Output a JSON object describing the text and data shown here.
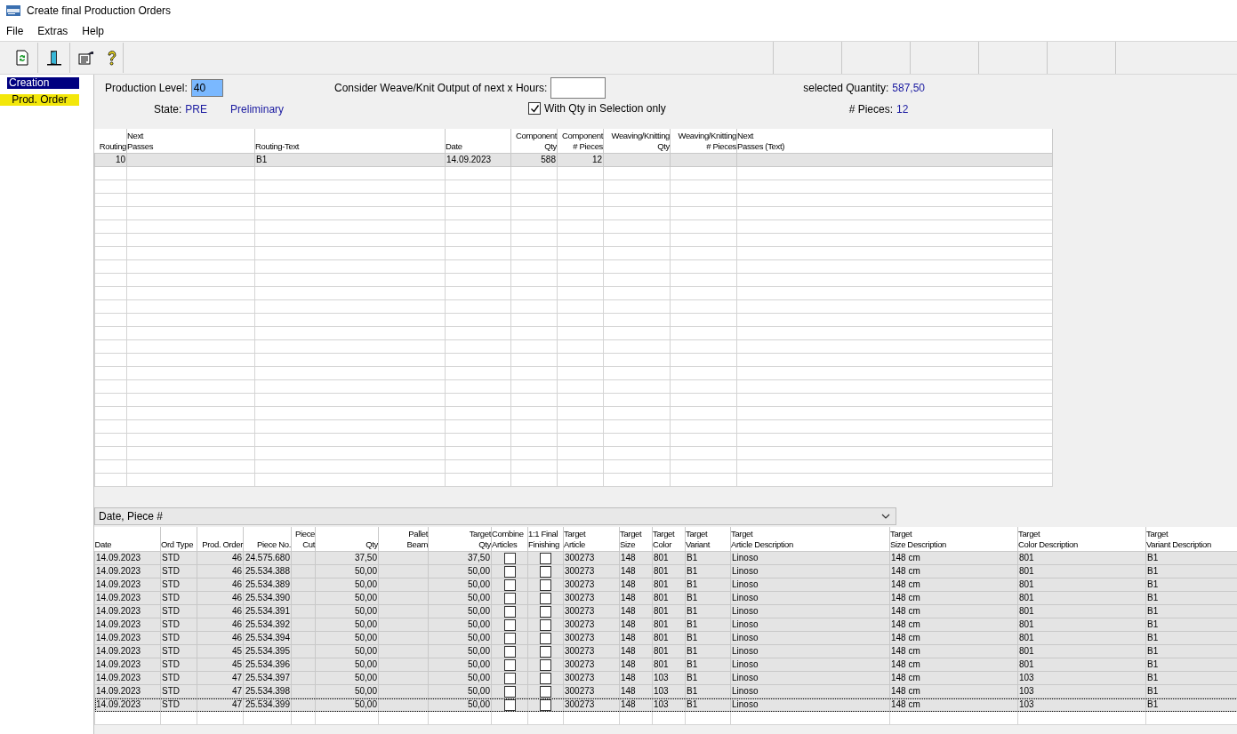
{
  "window": {
    "title": "Create final Production Orders"
  },
  "menu": [
    "File",
    "Extras",
    "Help"
  ],
  "nav": [
    {
      "kind": "group",
      "label": "Creation",
      "selected": false
    },
    {
      "kind": "item",
      "label": "Prod. Order",
      "selected": true
    }
  ],
  "form": {
    "production_level_label": "Production Level:",
    "production_level": "40",
    "state_label": "State:",
    "state_code": "PRE",
    "state_text": "Preliminary",
    "hours_label": "Consider Weave/Knit Output of next x Hours:",
    "qty_only_label": "With Qty in Selection only",
    "qty_only_checked": true,
    "selected_qty_label": "selected Quantity:",
    "selected_qty": "587,50",
    "pieces_label": "# Pieces:",
    "pieces": "12"
  },
  "routing_table": {
    "columns": [
      "Routing",
      "Next\nPasses",
      "Routing-Text",
      "Date",
      "Component\nQty",
      "Component\n# Pieces",
      "Weaving/Knitting\nQty",
      "Weaving/Knitting\n# Pieces",
      "Next\nPasses (Text)"
    ],
    "rows": [
      [
        "10",
        "",
        "B1",
        "14.09.2023",
        "588",
        "12",
        "",
        "",
        ""
      ]
    ]
  },
  "sort_dropdown": {
    "value": "Date, Piece #"
  },
  "orders_table": {
    "columns": [
      "Date",
      "Ord Type",
      "Prod. Order",
      "Piece No.",
      "Piece\nCut",
      "Qty",
      "Pallet\nBeam",
      "Target\nQty",
      "Combine\nArticles",
      "1:1 Final\nFinishing",
      "Target\nArticle",
      "Target\nSize",
      "Target\nColor",
      "Target\nVariant",
      "Target\nArticle Description",
      "Target\nSize Description",
      "Target\nColor Description",
      "Target\nVariant Description"
    ],
    "rows": [
      {
        "date": "14.09.2023",
        "ord_type": "STD",
        "prod_order": "46",
        "piece_no": "24.575.680",
        "qty": "37,50",
        "target_qty": "37,50",
        "combine": false,
        "finishing": false,
        "article": "300273",
        "size": "148",
        "color_code": "801",
        "variant": "B1",
        "article_desc": "Linoso",
        "size_desc": "148 cm",
        "color_desc": "801",
        "variant_desc": "B1",
        "selected": false
      },
      {
        "date": "14.09.2023",
        "ord_type": "STD",
        "prod_order": "46",
        "piece_no": "25.534.388",
        "qty": "50,00",
        "target_qty": "50,00",
        "combine": false,
        "finishing": false,
        "article": "300273",
        "size": "148",
        "color_code": "801",
        "variant": "B1",
        "article_desc": "Linoso",
        "size_desc": "148 cm",
        "color_desc": "801",
        "variant_desc": "B1",
        "selected": false
      },
      {
        "date": "14.09.2023",
        "ord_type": "STD",
        "prod_order": "46",
        "piece_no": "25.534.389",
        "qty": "50,00",
        "target_qty": "50,00",
        "combine": false,
        "finishing": false,
        "article": "300273",
        "size": "148",
        "color_code": "801",
        "variant": "B1",
        "article_desc": "Linoso",
        "size_desc": "148 cm",
        "color_desc": "801",
        "variant_desc": "B1",
        "selected": false
      },
      {
        "date": "14.09.2023",
        "ord_type": "STD",
        "prod_order": "46",
        "piece_no": "25.534.390",
        "qty": "50,00",
        "target_qty": "50,00",
        "combine": false,
        "finishing": false,
        "article": "300273",
        "size": "148",
        "color_code": "801",
        "variant": "B1",
        "article_desc": "Linoso",
        "size_desc": "148 cm",
        "color_desc": "801",
        "variant_desc": "B1",
        "selected": false
      },
      {
        "date": "14.09.2023",
        "ord_type": "STD",
        "prod_order": "46",
        "piece_no": "25.534.391",
        "qty": "50,00",
        "target_qty": "50,00",
        "combine": false,
        "finishing": false,
        "article": "300273",
        "size": "148",
        "color_code": "801",
        "variant": "B1",
        "article_desc": "Linoso",
        "size_desc": "148 cm",
        "color_desc": "801",
        "variant_desc": "B1",
        "selected": false
      },
      {
        "date": "14.09.2023",
        "ord_type": "STD",
        "prod_order": "46",
        "piece_no": "25.534.392",
        "qty": "50,00",
        "target_qty": "50,00",
        "combine": false,
        "finishing": false,
        "article": "300273",
        "size": "148",
        "color_code": "801",
        "variant": "B1",
        "article_desc": "Linoso",
        "size_desc": "148 cm",
        "color_desc": "801",
        "variant_desc": "B1",
        "selected": false
      },
      {
        "date": "14.09.2023",
        "ord_type": "STD",
        "prod_order": "46",
        "piece_no": "25.534.394",
        "qty": "50,00",
        "target_qty": "50,00",
        "combine": false,
        "finishing": false,
        "article": "300273",
        "size": "148",
        "color_code": "801",
        "variant": "B1",
        "article_desc": "Linoso",
        "size_desc": "148 cm",
        "color_desc": "801",
        "variant_desc": "B1",
        "selected": false
      },
      {
        "date": "14.09.2023",
        "ord_type": "STD",
        "prod_order": "45",
        "piece_no": "25.534.395",
        "qty": "50,00",
        "target_qty": "50,00",
        "combine": false,
        "finishing": false,
        "article": "300273",
        "size": "148",
        "color_code": "801",
        "variant": "B1",
        "article_desc": "Linoso",
        "size_desc": "148 cm",
        "color_desc": "801",
        "variant_desc": "B1",
        "selected": false
      },
      {
        "date": "14.09.2023",
        "ord_type": "STD",
        "prod_order": "45",
        "piece_no": "25.534.396",
        "qty": "50,00",
        "target_qty": "50,00",
        "combine": false,
        "finishing": false,
        "article": "300273",
        "size": "148",
        "color_code": "801",
        "variant": "B1",
        "article_desc": "Linoso",
        "size_desc": "148 cm",
        "color_desc": "801",
        "variant_desc": "B1",
        "selected": false
      },
      {
        "date": "14.09.2023",
        "ord_type": "STD",
        "prod_order": "47",
        "piece_no": "25.534.397",
        "qty": "50,00",
        "target_qty": "50,00",
        "combine": false,
        "finishing": false,
        "article": "300273",
        "size": "148",
        "color_code": "103",
        "variant": "B1",
        "article_desc": "Linoso",
        "size_desc": "148 cm",
        "color_desc": "103",
        "variant_desc": "B1",
        "selected": false
      },
      {
        "date": "14.09.2023",
        "ord_type": "STD",
        "prod_order": "47",
        "piece_no": "25.534.398",
        "qty": "50,00",
        "target_qty": "50,00",
        "combine": false,
        "finishing": false,
        "article": "300273",
        "size": "148",
        "color_code": "103",
        "variant": "B1",
        "article_desc": "Linoso",
        "size_desc": "148 cm",
        "color_desc": "103",
        "variant_desc": "B1",
        "selected": false
      },
      {
        "date": "14.09.2023",
        "ord_type": "STD",
        "prod_order": "47",
        "piece_no": "25.534.399",
        "qty": "50,00",
        "target_qty": "50,00",
        "combine": false,
        "finishing": false,
        "article": "300273",
        "size": "148",
        "color_code": "103",
        "variant": "B1",
        "article_desc": "Linoso",
        "size_desc": "148 cm",
        "color_desc": "103",
        "variant_desc": "B1",
        "selected": true
      }
    ]
  }
}
